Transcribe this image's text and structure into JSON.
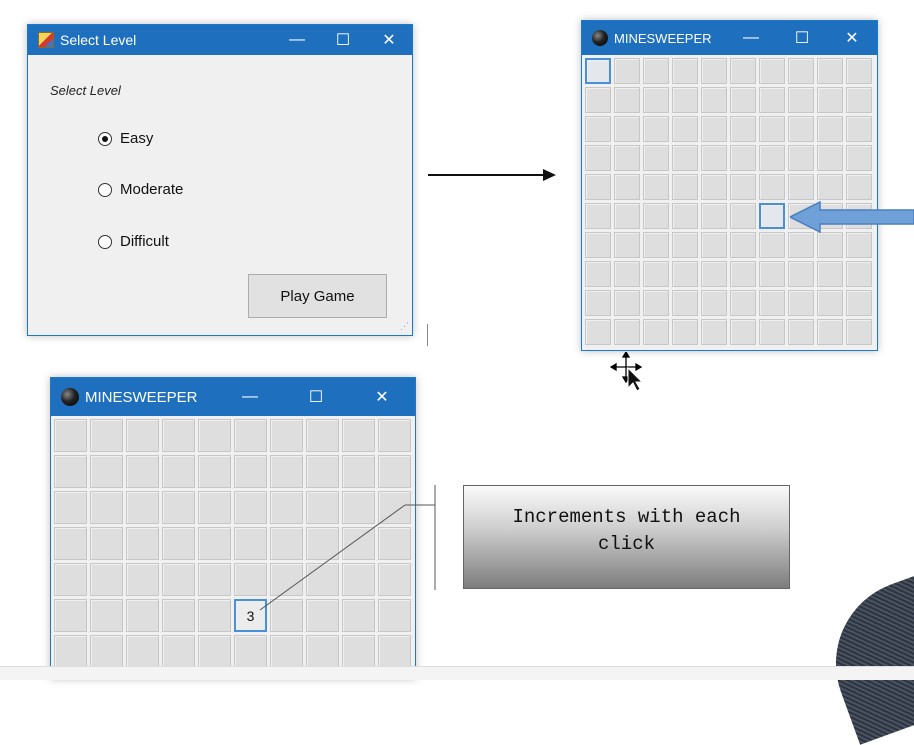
{
  "select_window": {
    "title": "Select Level",
    "minimize": "—",
    "maximize": "☐",
    "close": "✕",
    "group_label": "Select Level",
    "options": [
      "Easy",
      "Moderate",
      "Difficult"
    ],
    "selected": "Easy",
    "play_button": "Play Game"
  },
  "game_window_1": {
    "title": "MINESWEEPER",
    "minimize": "—",
    "maximize": "☐",
    "close": "✕",
    "rows": 10,
    "cols": 10
  },
  "game_window_2": {
    "title": "MINESWEEPER",
    "minimize": "—",
    "maximize": "☐",
    "close": "✕",
    "cell_value": "3"
  },
  "callout": {
    "text_line1": "Increments with each",
    "text_line2": "click"
  },
  "colors": {
    "titlebar": "#1f6fbf",
    "highlight": "#4a90d9",
    "arrow": "#5b93cf"
  }
}
